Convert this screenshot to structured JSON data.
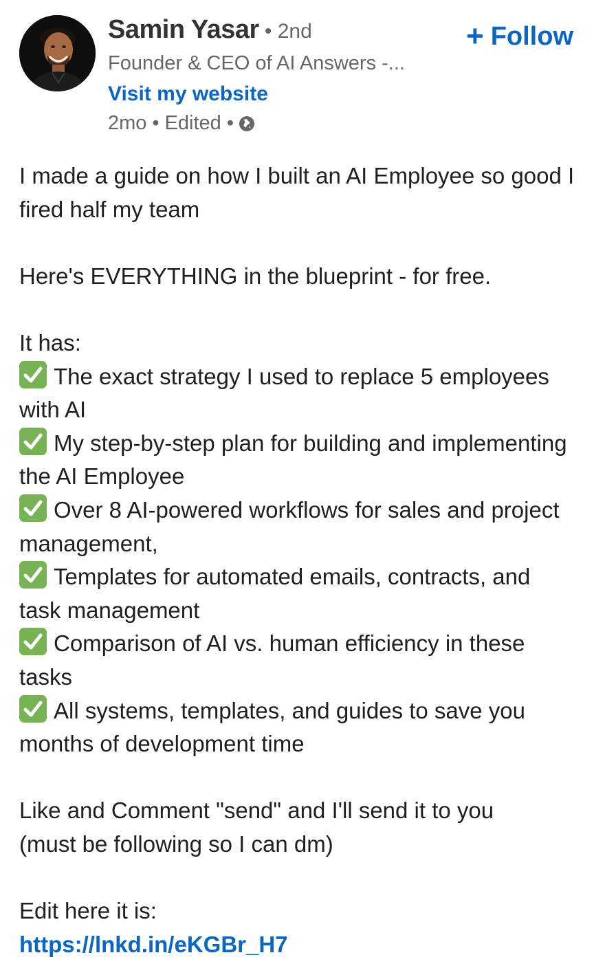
{
  "author": {
    "name": "Samin Yasar",
    "separator": "•",
    "degree": "2nd",
    "headline": "Founder & CEO of AI Answers -...",
    "website_label": "Visit my website",
    "time": "2mo",
    "edited": "Edited",
    "visibility_icon": "globe-icon"
  },
  "follow_button": {
    "label": "Follow",
    "icon": "plus-icon"
  },
  "post": {
    "intro": "I made a guide on how I built an AI Employee so good I fired half my team",
    "everything": "Here's EVERYTHING in the blueprint - for free.",
    "it_has": "It has:",
    "check_icon": "white-heavy-check-mark-icon",
    "checklist": [
      "The exact strategy I used to replace 5 employees with AI",
      "My step-by-step plan for building and implementing the AI Employee",
      "Over 8 AI-powered workflows for sales and project management,",
      "Templates for automated emails, contracts, and task management",
      "Comparison of AI vs. human efficiency in these tasks",
      "All systems, templates, and guides to save you months of development time"
    ],
    "cta_line1": "Like and Comment \"send\" and I'll send it to you",
    "cta_line2": "(must be following so I can dm)",
    "edit_note": "Edit here it is:",
    "link": "https://lnkd.in/eKGBr_H7"
  },
  "colors": {
    "link_blue": "#0a66c2",
    "check_green": "#77b255",
    "muted_text": "#666666"
  }
}
